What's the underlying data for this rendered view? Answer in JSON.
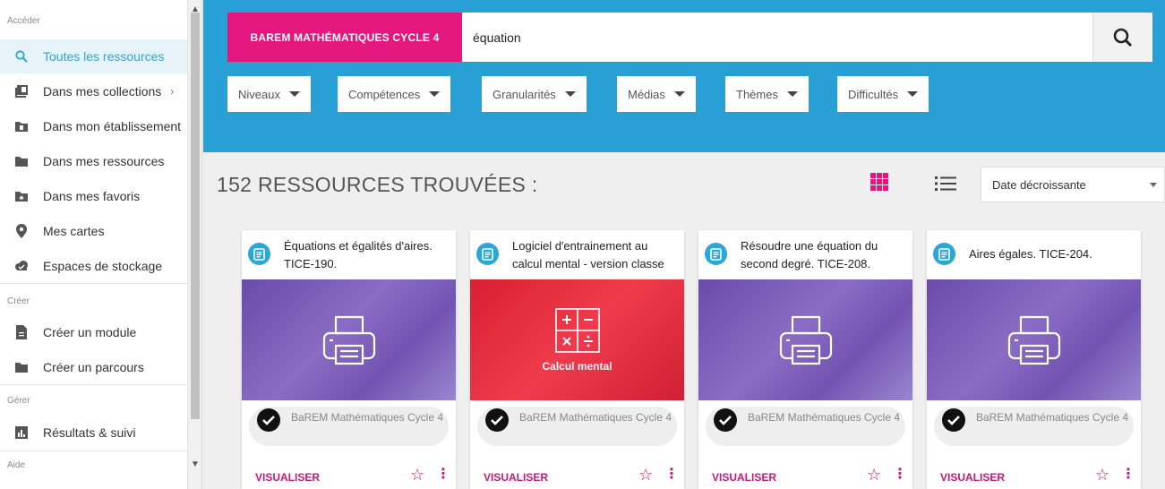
{
  "sidebar": {
    "sections": {
      "acceder": "Accéder",
      "creer": "Créer",
      "gerer": "Gérer",
      "aide": "Aide"
    },
    "items": [
      {
        "label": "Toutes les ressources",
        "icon": "search-icon"
      },
      {
        "label": "Dans mes collections",
        "icon": "collections-icon"
      },
      {
        "label": "Dans mon établissement",
        "icon": "school-icon"
      },
      {
        "label": "Dans mes ressources",
        "icon": "folder-icon"
      },
      {
        "label": "Dans mes favoris",
        "icon": "favorite-folder-icon"
      },
      {
        "label": "Mes cartes",
        "icon": "map-pin-icon"
      },
      {
        "label": "Espaces de stockage",
        "icon": "cloud-icon"
      },
      {
        "label": "Créer un module",
        "icon": "document-icon"
      },
      {
        "label": "Créer un parcours",
        "icon": "folder-icon"
      },
      {
        "label": "Résultats & suivi",
        "icon": "chart-icon"
      }
    ],
    "collections_chevron": "›"
  },
  "search": {
    "category": "BAREM MATHÉMATIQUES CYCLE 4",
    "query": "équation"
  },
  "filters": [
    "Niveaux",
    "Compétences",
    "Granularités",
    "Médias",
    "Thèmes",
    "Difficultés"
  ],
  "results": {
    "title": "152 RESSOURCES TROUVÉES :",
    "sort": "Date décroissante"
  },
  "cards": [
    {
      "title": "Équations et égalités d'aires. TICE-190.",
      "media": "printer",
      "source": "BaREM Mathématiques Cycle 4",
      "action": "VISUALISER"
    },
    {
      "title": "Logiciel d'entrainement au calcul mental - version classe",
      "media": "calcul",
      "media_label": "Calcul mental",
      "source": "BaREM Mathématiques Cycle 4",
      "action": "VISUALISER"
    },
    {
      "title": "Résoudre une équation du second degré. TICE-208.",
      "media": "printer",
      "source": "BaREM Mathématiques Cycle 4",
      "action": "VISUALISER"
    },
    {
      "title": "Aires égales. TICE-204.",
      "media": "printer",
      "source": "BaREM Mathématiques Cycle 4",
      "action": "VISUALISER"
    }
  ],
  "colors": {
    "header_blue": "#29a0d5",
    "brand_pink": "#e4177f",
    "active_blue": "#2aa7d6",
    "media_purple": "#7253b2",
    "media_red": "#d91f32"
  }
}
